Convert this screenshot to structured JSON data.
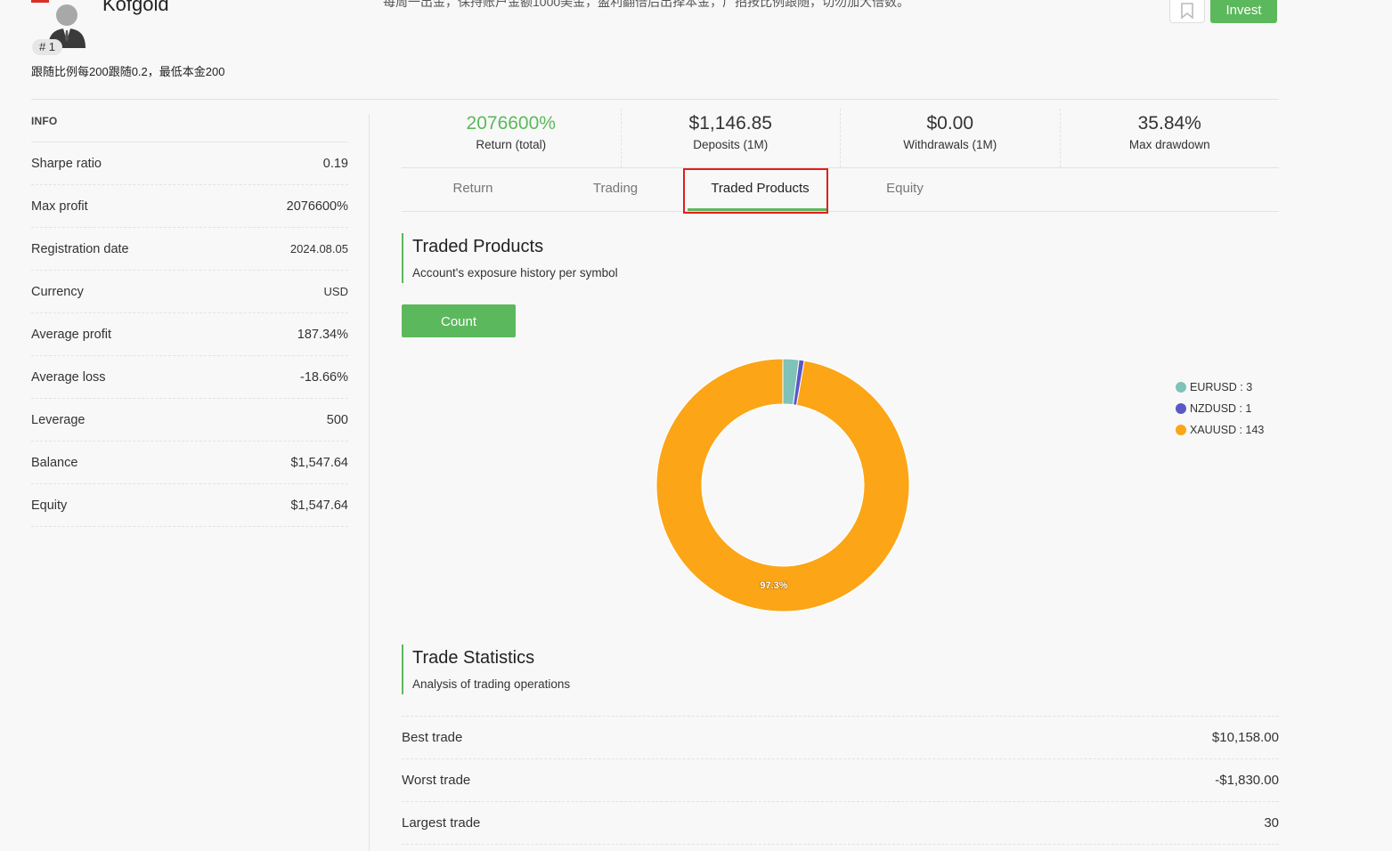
{
  "profile": {
    "name": "Kofgold",
    "rank": "# 1",
    "subtitle": "跟随比例每200跟随0.2，最低本金200",
    "description": "每周一出金，保持账户金额1000美金，盈利翻倍后出择本金，广招按比例跟随，切勿加大倍数。"
  },
  "actions": {
    "invest_label": "Invest",
    "bookmark_icon": "bookmark-icon"
  },
  "info": {
    "title": "INFO",
    "rows": [
      {
        "label": "Sharpe ratio",
        "value": "0.19"
      },
      {
        "label": "Max profit",
        "value": "2076600%"
      },
      {
        "label": "Registration date",
        "value": "2024.08.05"
      },
      {
        "label": "Currency",
        "value": "USD"
      },
      {
        "label": "Average profit",
        "value": "187.34%"
      },
      {
        "label": "Average loss",
        "value": "-18.66%"
      },
      {
        "label": "Leverage",
        "value": "500"
      },
      {
        "label": "Balance",
        "value": "$1,547.64"
      },
      {
        "label": "Equity",
        "value": "$1,547.64"
      }
    ]
  },
  "stats": [
    {
      "value": "2076600%",
      "label": "Return (total)"
    },
    {
      "value": "$1,146.85",
      "label": "Deposits (1M)"
    },
    {
      "value": "$0.00",
      "label": "Withdrawals (1M)"
    },
    {
      "value": "35.84%",
      "label": "Max drawdown"
    }
  ],
  "tabs": [
    {
      "label": "Return"
    },
    {
      "label": "Trading"
    },
    {
      "label": "Traded Products"
    },
    {
      "label": "Equity"
    }
  ],
  "traded_products": {
    "title": "Traded Products",
    "subtitle": "Account's exposure history per symbol",
    "count_button": "Count",
    "slice_label": "97.3%"
  },
  "chart_data": {
    "type": "pie",
    "categories": [
      "EURUSD",
      "NZDUSD",
      "XAUUSD"
    ],
    "values": [
      3,
      1,
      143
    ],
    "colors": [
      "#7fc2b8",
      "#5a58c8",
      "#fba517"
    ],
    "legend_labels": [
      "EURUSD : 3",
      "NZDUSD : 1",
      "XAUUSD : 143"
    ],
    "data_labels": [
      "",
      "",
      "97.3%"
    ],
    "legend_position": "right",
    "donut": true
  },
  "trade_statistics": {
    "title": "Trade Statistics",
    "subtitle": "Analysis of trading operations",
    "rows": [
      {
        "label": "Best trade",
        "value": "$10,158.00"
      },
      {
        "label": "Worst trade",
        "value": "-$1,830.00"
      },
      {
        "label": "Largest trade",
        "value": "30"
      }
    ]
  },
  "colors": {
    "accent": "#5cb85c",
    "highlight": "#e0201c"
  }
}
